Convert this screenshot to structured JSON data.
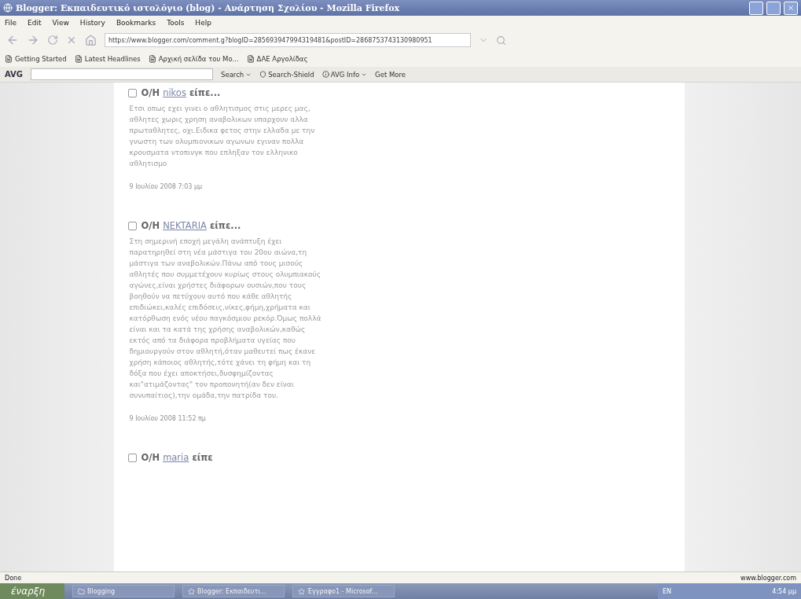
{
  "window": {
    "title": "Blogger: Εκπαιδευτικό ιστολόγιο (blog) - Ανάρτηση Σχολίου - Mozilla Firefox"
  },
  "menu": [
    "File",
    "Edit",
    "View",
    "History",
    "Bookmarks",
    "Tools",
    "Help"
  ],
  "address_bar": {
    "value": "https://www.blogger.com/comment.g?blogID=285693947994319481&postID=2868753743130980951"
  },
  "bookmarks": [
    "Getting Started",
    "Latest Headlines",
    "Αρχική σελίδα του Mo...",
    "ΔΑΕ Αργολίδας"
  ],
  "avg_toolbar": {
    "label": "AVG",
    "items": [
      {
        "label": "Search",
        "kind": "menu"
      },
      {
        "label": "Search-Shield",
        "kind": "plain"
      },
      {
        "label": "AVG Info",
        "kind": "menu"
      },
      {
        "label": "Get More",
        "kind": "plain"
      }
    ]
  },
  "comments": [
    {
      "prefix": "O/H",
      "author": "nikos",
      "verb": "είπε...",
      "body": "Ετσι οπως εχει γινει ο αθλητισμος στις μερες μας, αθλητες χωρις χρηση αναβολικων υπαρχουν αλλα πρωταθλητες, οχι.Ειδικα φετος στην ελλαδα με την γνωστη των ολυμπιονικων αγωνων εγιναν πολλα κρουσματα ντοπινγκ που επληξαν τον ελληνικο αθλητισμο",
      "date": "9 Ιουλίου 2008 7:03 μμ"
    },
    {
      "prefix": "O/H",
      "author": "NEKTARIA",
      "verb": "είπε...",
      "body": "Στη σημερινή εποχή μεγάλη ανάπτυξη έχει παρατηρηθεί στη νέα μάστιγα του 20ου αιώνα,τη μάστιγα των αναβολικών.Πάνω από τους μισούς αθλητές που συμμετέχουν κυρίως στους ολυμπιακούς αγώνες,είναι χρήστες διάφορων ουσιών,που τους βοηθούν να πετύχουν αυτό που κάθε αθλητής επιδιώκει,καλές επιδόσεις,νίκες,φήμη,χρήματα και κατόρθωση ενός νέου παγκόσμιου ρεκόρ.Όμως πολλά είναι και τα κατά της χρήσης αναβολικών,καθώς εκτός από τα διάφορα προβλήματα υγείας που δημιουργούν στον αθλητή,όταν μαθευτεί πως έκανε χρήση κάποιος αθλητής,τότε χάνει τη φήμη και τη δόξα που έχει αποκτήσει,δυσφημίζοντας και\"ατιμάζοντας\" τον προπονητή(αν δεν είναι συνυπαίτιος),την ομάδα,την πατρίδα του.",
      "date": "9 Ιουλίου 2008 11:52 πμ"
    },
    {
      "prefix": "O/H",
      "author": "maria",
      "verb": "είπε"
    }
  ],
  "status_bar": {
    "left": "Done",
    "right": "www.blogger.com"
  },
  "taskbar": {
    "start": "έναρξη",
    "tasks": [
      "Blogging",
      "Blogger: Εκπαιδευτι...",
      "Έγγραφο1 - Microsof..."
    ],
    "language": "EN",
    "clock": "4:54 μμ"
  }
}
